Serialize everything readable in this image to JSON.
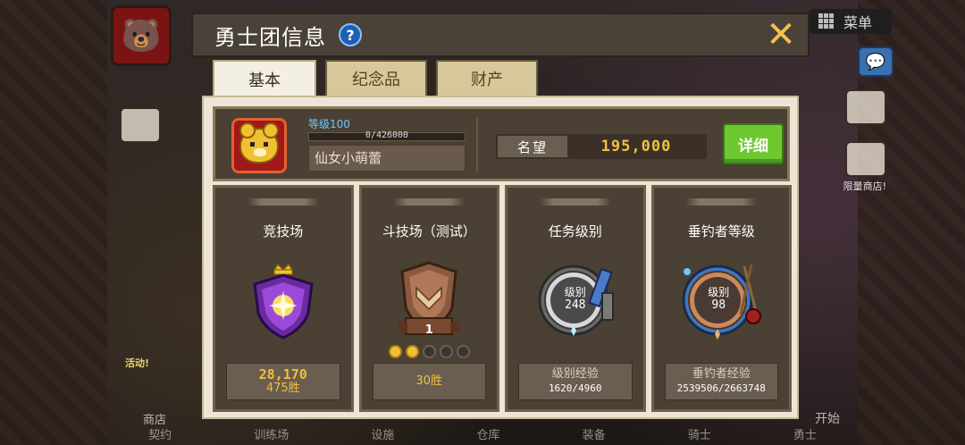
{
  "background": {
    "menu_label": "菜单",
    "shop_tag": "活动!",
    "shop_label": "商店",
    "start_label": "开始",
    "limited_label": "限量商店!",
    "bottom_nav": [
      "契约",
      "训练场",
      "设施",
      "仓库",
      "装备",
      "骑士",
      "勇士"
    ]
  },
  "dialog": {
    "title": "勇士团信息",
    "help_icon": "?",
    "close_icon": "✕",
    "tabs": [
      {
        "label": "基本",
        "active": true
      },
      {
        "label": "纪念品",
        "active": false
      },
      {
        "label": "财产",
        "active": false
      }
    ]
  },
  "player": {
    "level_label": "等级100",
    "exp_text": "0/426000",
    "exp_progress": 0,
    "name": "仙女小萌蕾",
    "reputation_label": "名望",
    "reputation_value": "195,000",
    "detail_button": "详细"
  },
  "cards": [
    {
      "title": "竞技场",
      "main": "28,170",
      "sub": "475胜",
      "emblem": "purple-shield-emblem"
    },
    {
      "title": "斗技场（测试）",
      "rank_number": "1",
      "sub": "30胜",
      "stars_filled": 2,
      "stars_total": 5,
      "emblem": "bronze-shield-emblem"
    },
    {
      "title": "任务级别",
      "emblem_label": "级别",
      "emblem_value": "248",
      "label": "级别经验",
      "value": "1620/4960",
      "emblem": "gear-level-emblem"
    },
    {
      "title": "垂钓者等级",
      "emblem_label": "级别",
      "emblem_value": "98",
      "label": "垂钓者经验",
      "value": "2539506/2663748",
      "emblem": "fishing-level-emblem"
    }
  ],
  "colors": {
    "accent_gold": "#f0c040",
    "detail_green": "#6ec830",
    "panel_dark": "#4a4034",
    "level_blue": "#6ac8ff"
  }
}
